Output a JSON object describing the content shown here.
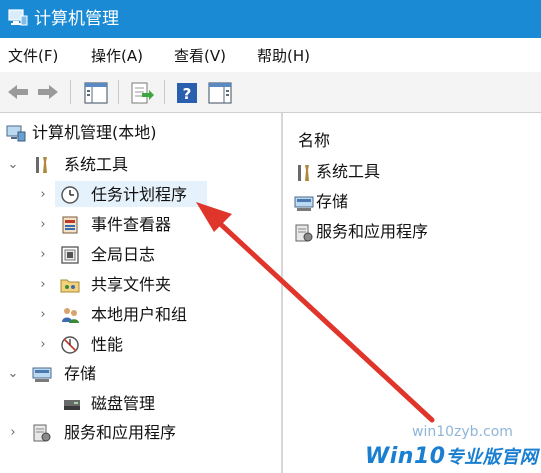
{
  "window": {
    "title": "计算机管理"
  },
  "menu": [
    "文件(F)",
    "操作(A)",
    "查看(V)",
    "帮助(H)"
  ],
  "toolbar": [
    "back-icon",
    "forward-icon",
    "show-hide-console-tree-icon",
    "export-list-icon",
    "help-icon",
    "show-hide-action-pane-icon"
  ],
  "tree": {
    "root": "计算机管理(本地)",
    "system_tools": "系统工具",
    "task_scheduler": "任务计划程序",
    "event_viewer": "事件查看器",
    "global_log": "全局日志",
    "shared_folders": "共享文件夹",
    "local_users": "本地用户和组",
    "performance": "性能",
    "storage": "存储",
    "disk_management": "磁盘管理",
    "services_apps": "服务和应用程序"
  },
  "right": {
    "column_header": "名称",
    "items": [
      "系统工具",
      "存储",
      "服务和应用程序"
    ]
  },
  "watermark": {
    "url": "win10zyb.com",
    "brand": "Win10",
    "brand_suffix": "专业版官网"
  },
  "colors": {
    "titlebar": "#1a8ad4",
    "annotation_arrow": "#e0352b",
    "selection": "#e5f1fb"
  }
}
